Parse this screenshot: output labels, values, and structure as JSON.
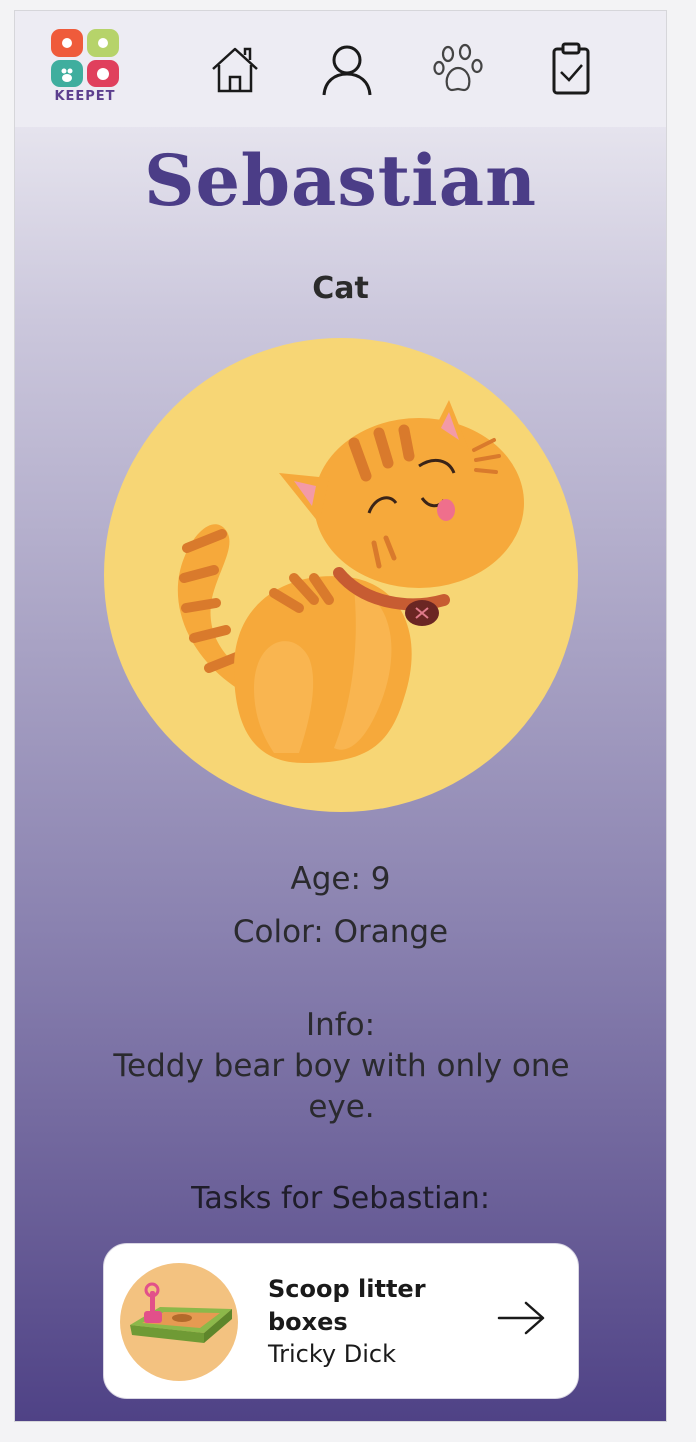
{
  "app": {
    "logo_text": "KEEPET"
  },
  "nav": [
    {
      "name": "home",
      "icon": "home-icon"
    },
    {
      "name": "profile",
      "icon": "user-icon"
    },
    {
      "name": "pets",
      "icon": "paw-icon"
    },
    {
      "name": "tasks",
      "icon": "clipboard-check-icon"
    }
  ],
  "pet": {
    "name": "Sebastian",
    "species": "Cat",
    "age": "Age: 9",
    "color": "Color: Orange",
    "info_label": "Info:",
    "info_text": "Teddy bear boy with only one eye.",
    "image_icon": "orange-cat-illustration"
  },
  "tasks_section": {
    "title": "Tasks for Sebastian:",
    "tasks": [
      {
        "title": "Scoop litter boxes",
        "assignee": "Tricky Dick",
        "icon": "litter-box-icon"
      }
    ]
  },
  "colors": {
    "accent": "#4b3d87",
    "pet_circle": "#f7d675",
    "task_thumb": "#f3c280"
  }
}
